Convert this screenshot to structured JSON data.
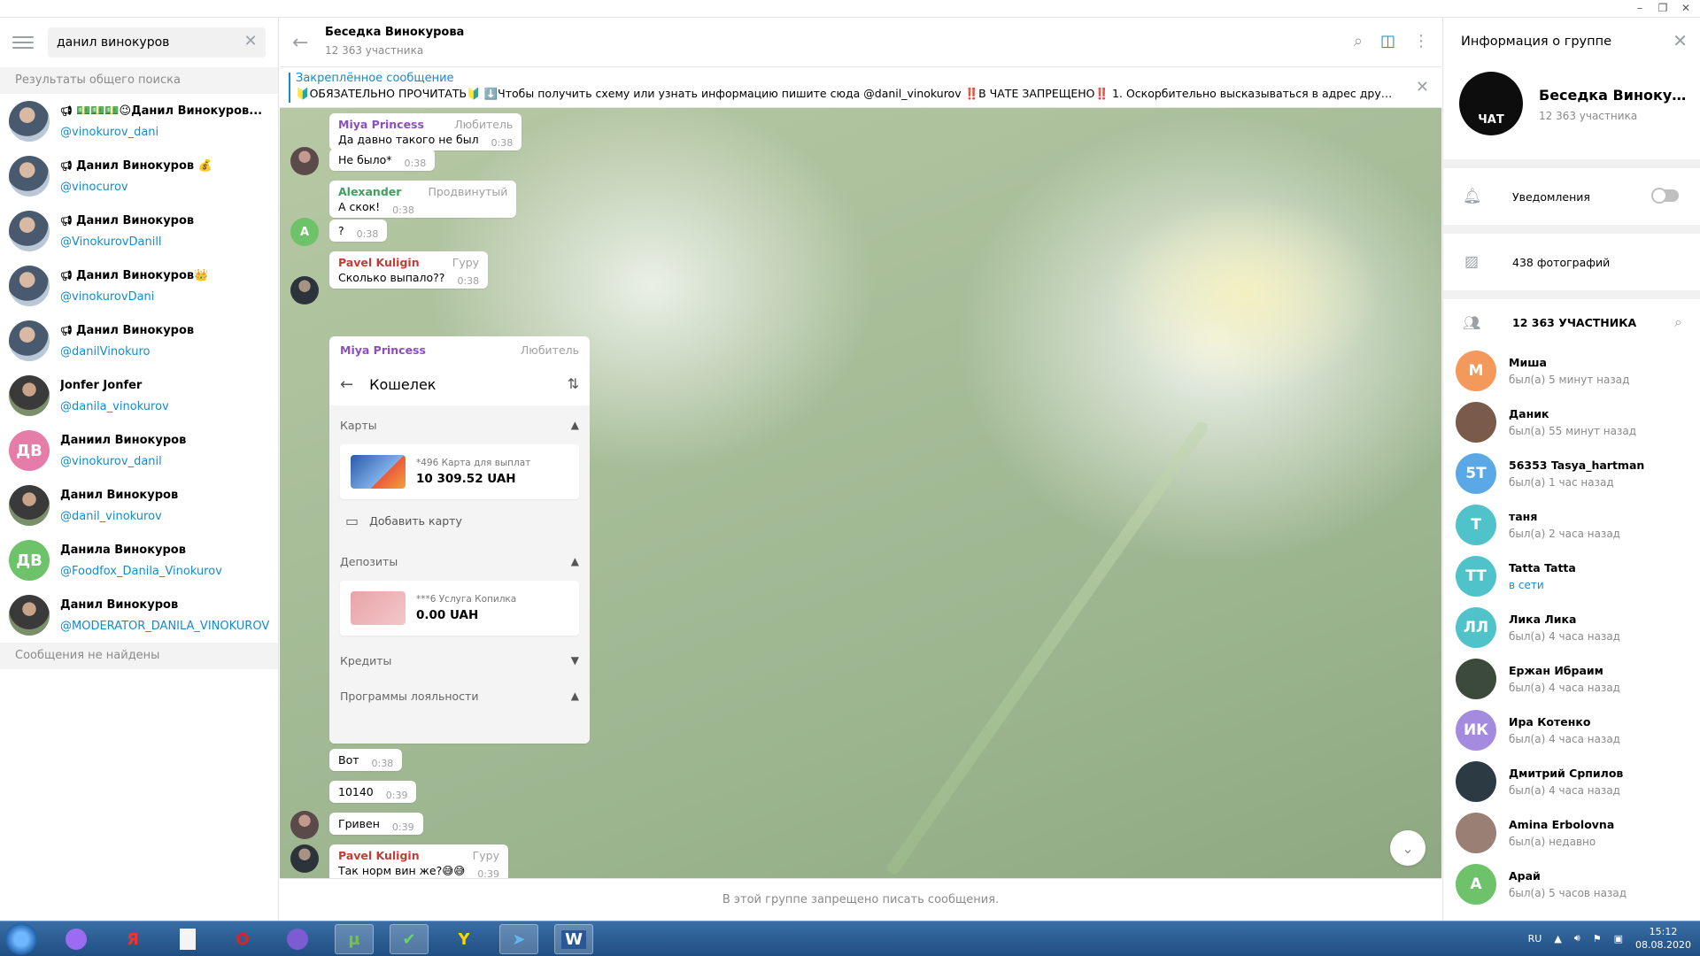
{
  "window": {
    "controls": [
      "–",
      "❐",
      "✕"
    ]
  },
  "search": {
    "query": "данил винокуров",
    "global_results_label": "Результаты общего поиска",
    "no_messages_label": "Сообщения не найдены",
    "results": [
      {
        "name": "💵💵💵😉Данил Винокуров...",
        "username": "@vinokurov_dani",
        "avatar": "photo",
        "channel": true
      },
      {
        "name": "Данил Винокуров 💰",
        "username": "@vinocurov",
        "avatar": "photo",
        "channel": true
      },
      {
        "name": "Данил Винокуров",
        "username": "@VinokurovDanill",
        "avatar": "photo",
        "channel": true
      },
      {
        "name": "Данил Винокуров👑",
        "username": "@vinokurovDani",
        "avatar": "photo",
        "channel": true
      },
      {
        "name": "Данил Винокуров",
        "username": "@danilVinokuro",
        "avatar": "photo",
        "channel": true
      },
      {
        "name": "Jonfer Jonfer",
        "username": "@danila_vinokurov",
        "avatar": "dark",
        "channel": false
      },
      {
        "name": "Даниил Винокуров",
        "username": "@vinokurov_danil",
        "avatar": "rose",
        "initials": "ДВ",
        "channel": false
      },
      {
        "name": "Данил Винокуров",
        "username": "@danil_vinokurov",
        "avatar": "dark",
        "channel": false
      },
      {
        "name": "Данила Винокуров",
        "username": "@Foodfox_Danila_Vinokurov",
        "avatar": "green",
        "initials": "ДВ",
        "channel": false
      },
      {
        "name": "Данил Винокуров",
        "username": "@MODERATOR_DANILA_VINOKUROV",
        "avatar": "dark",
        "channel": false
      }
    ]
  },
  "chat": {
    "title": "Беседка Винокурова",
    "subtitle": "12 363 участника",
    "pinned_title": "Закреплённое сообщение",
    "pinned_text": "🔰ОБЯЗАТЕЛЬНО ПРОЧИТАТЬ🔰 ⬇️Чтобы получить схему или узнать информацию пишите сюда @danil_vinokurov ‼️В ЧАТЕ ЗАПРЕЩЕНО‼️ 1. Оскорбительно высказываться в адрес других ...",
    "compose_notice": "В этой группе запрещено писать сообщения.",
    "messages": [
      {
        "author": "Miya Princess",
        "role": "Любитель",
        "text": "Да давно такого не был",
        "time": "0:38"
      },
      {
        "text": "Не было*",
        "time": "0:38"
      },
      {
        "author": "Alexander",
        "role": "Продвинутый",
        "text": "А скок!",
        "time": "0:38"
      },
      {
        "text": "?",
        "time": "0:38",
        "avatar_letter": "A"
      },
      {
        "author": "Pavel Kuligin",
        "role": "Гуру",
        "text": "Сколько выпало??",
        "time": "0:38"
      },
      {
        "text": "Вот",
        "time": "0:38"
      },
      {
        "text": "10140",
        "time": "0:39"
      },
      {
        "text": "Гривен",
        "time": "0:39"
      },
      {
        "author": "Pavel Kuligin",
        "role": "Гуру",
        "text": "Так норм вин же?😅😅",
        "time": "0:39"
      }
    ],
    "wallet_post": {
      "author": "Miya Princess",
      "role": "Любитель",
      "title": "Кошелек",
      "cards_label": "Карты",
      "card_sub": "*496 Карта для выплат",
      "card_amount": "10 309.52 UAH",
      "add_card": "Добавить карту",
      "deposits_label": "Депозиты",
      "deposit_sub": "***6 Услуга Копилка",
      "deposit_amount": "0.00 UAH",
      "credits_label": "Кредиты",
      "loyalty_label": "Программы лояльности"
    }
  },
  "info": {
    "title": "Информация о группе",
    "group_name": "Беседка Винокуро...",
    "group_sub": "12 363 участника",
    "avatar_text": "ЧАТ",
    "notifications": "Уведомления",
    "photos": "438 фотографий",
    "members_header": "12 363 УЧАСТНИКА",
    "members": [
      {
        "name": "Миша",
        "status": "был(а) 5 минут назад",
        "initials": "М",
        "color": "#f3995b"
      },
      {
        "name": "Даник",
        "status": "был(а) 55 минут назад",
        "initials": "",
        "color": "#7a5a4a"
      },
      {
        "name": "56353 Tasya_hartman",
        "status": "был(а) 1 час назад",
        "initials": "5T",
        "color": "#5aa9e6"
      },
      {
        "name": "таня",
        "status": "был(а) 2 часа назад",
        "initials": "Т",
        "color": "#4fc3c9"
      },
      {
        "name": "Tatta Tatta",
        "status": "в сети",
        "initials": "TT",
        "color": "#4fc3c9",
        "online": true
      },
      {
        "name": "Лика Лика",
        "status": "был(а) 4 часа назад",
        "initials": "ЛЛ",
        "color": "#4fc3c9"
      },
      {
        "name": "Ержан Ибраим",
        "status": "был(а) 4 часа назад",
        "initials": "",
        "color": "#3c4a3c"
      },
      {
        "name": "Ира Котенко",
        "status": "был(а) 4 часа назад",
        "initials": "ИК",
        "color": "#a58be0"
      },
      {
        "name": "Дмитрий Српилов",
        "status": "был(а) 4 часа назад",
        "initials": "",
        "color": "#2c3a44"
      },
      {
        "name": "Amina Erbolovna",
        "status": "был(а) недавно",
        "initials": "",
        "color": "#9a7f74"
      },
      {
        "name": "Арай",
        "status": "был(а) 5 часов назад",
        "initials": "A",
        "color": "#6dc26a"
      }
    ]
  },
  "taskbar": {
    "apps": [
      "Алиса",
      "Я",
      "Файл",
      "Opera",
      "Viber",
      "uTorrent",
      "Касперский",
      "Яндекс",
      "Telegram",
      "Word"
    ],
    "lang": "RU",
    "time": "15:12",
    "date": "08.08.2020"
  }
}
